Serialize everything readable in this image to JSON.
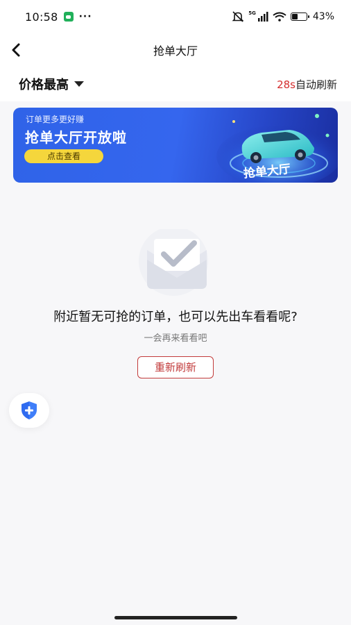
{
  "status_bar": {
    "time": "10:58",
    "more": "···",
    "network": "5G",
    "battery_percent": "43%",
    "battery_level": 0.43
  },
  "nav": {
    "title": "抢单大厅"
  },
  "filter": {
    "sort_label": "价格最高",
    "refresh_seconds": "28s",
    "refresh_suffix": "自动刷新"
  },
  "banner": {
    "subtitle": "订单更多更好赚",
    "title": "抢单大厅开放啦",
    "button_label": "点击查看",
    "art_text": "抢单大厅"
  },
  "empty_state": {
    "title": "附近暂无可抢的订单，也可以先出车看看呢?",
    "subtitle": "一会再来看看吧",
    "button_label": "重新刷新"
  },
  "colors": {
    "accent_red": "#c23b3b",
    "banner_blue": "#2f63e8",
    "banner_button": "#f5d63c",
    "safety_blue": "#2f6bf0"
  },
  "icons": {
    "back": "chevron-left-icon",
    "sort": "caret-down-icon",
    "safety": "shield-plus-icon",
    "empty": "checkmark-envelope-icon"
  }
}
